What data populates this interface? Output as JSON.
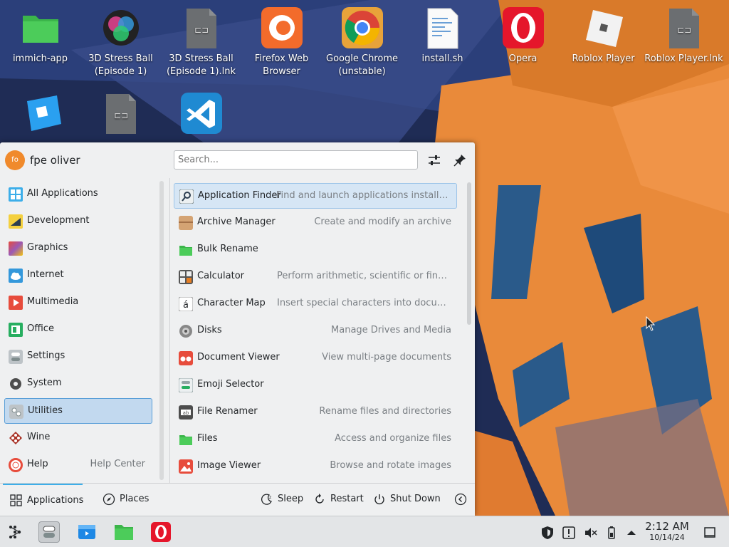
{
  "desktop": {
    "icons": [
      {
        "label": "immich-app",
        "icon": "folder-icon"
      },
      {
        "label": "3D Stress Ball (Episode 1)",
        "icon": "stress-ball-icon"
      },
      {
        "label": "3D Stress Ball (Episode 1).lnk",
        "icon": "link-file-icon"
      },
      {
        "label": "Firefox Web Browser",
        "icon": "firefox-icon"
      },
      {
        "label": "Google Chrome (unstable)",
        "icon": "chrome-icon"
      },
      {
        "label": "install.sh",
        "icon": "script-file-icon"
      },
      {
        "label": "Opera",
        "icon": "opera-icon"
      },
      {
        "label": "Roblox Player",
        "icon": "roblox-icon"
      },
      {
        "label": "Roblox Player.lnk",
        "icon": "link-file-icon"
      },
      {
        "label": "",
        "icon": "roblox-studio-icon"
      },
      {
        "label": "",
        "icon": "link-file-icon"
      },
      {
        "label": "",
        "icon": "vscode-icon"
      }
    ]
  },
  "menu": {
    "user": {
      "initials": "fo",
      "name": "fpe oliver"
    },
    "search": {
      "placeholder": "Search..."
    },
    "categories": [
      {
        "label": "All Applications",
        "icon": "grid-icon",
        "color": "#3daee9"
      },
      {
        "label": "Development",
        "icon": "development-icon",
        "color": "#f4d03f"
      },
      {
        "label": "Graphics",
        "icon": "graphics-icon",
        "color": "#c0392b"
      },
      {
        "label": "Internet",
        "icon": "internet-icon",
        "color": "#3498db"
      },
      {
        "label": "Multimedia",
        "icon": "multimedia-icon",
        "color": "#e74c3c"
      },
      {
        "label": "Office",
        "icon": "office-icon",
        "color": "#27ae60"
      },
      {
        "label": "Settings",
        "icon": "settings-icon",
        "color": "#95a5a6"
      },
      {
        "label": "System",
        "icon": "system-icon",
        "color": "#4d4d4d"
      },
      {
        "label": "Utilities",
        "icon": "utilities-icon",
        "color": "#bdc3c7",
        "selected": true
      },
      {
        "label": "Wine",
        "icon": "wine-icon",
        "color": "#a93226"
      },
      {
        "label": "Help",
        "icon": "help-icon",
        "color": "#e74c3c",
        "sub": "Help Center"
      }
    ],
    "apps": [
      {
        "name": "Application Finder",
        "desc": "Find and launch applications installed...",
        "icon": "magnifier-icon",
        "color": "#7f8c8d",
        "selected": true
      },
      {
        "name": "Archive Manager",
        "desc": "Create and modify an archive",
        "icon": "archive-icon",
        "color": "#d4a373"
      },
      {
        "name": "Bulk Rename",
        "desc": "",
        "icon": "folder-icon",
        "color": "#4caf50"
      },
      {
        "name": "Calculator",
        "desc": "Perform arithmetic, scientific or financial calc...",
        "icon": "calculator-icon",
        "color": "#555555"
      },
      {
        "name": "Character Map",
        "desc": "Insert special characters into documents",
        "icon": "character-map-icon",
        "color": "#ffffff"
      },
      {
        "name": "Disks",
        "desc": "Manage Drives and Media",
        "icon": "disk-icon",
        "color": "#888888"
      },
      {
        "name": "Document Viewer",
        "desc": "View multi-page documents",
        "icon": "document-viewer-icon",
        "color": "#e74c3c"
      },
      {
        "name": "Emoji Selector",
        "desc": "",
        "icon": "emoji-icon",
        "color": "#95a5a6"
      },
      {
        "name": "File Renamer",
        "desc": "Rename files and directories",
        "icon": "file-renamer-icon",
        "color": "#4d4d4d"
      },
      {
        "name": "Files",
        "desc": "Access and organize files",
        "icon": "folder-icon",
        "color": "#4caf50"
      },
      {
        "name": "Image Viewer",
        "desc": "Browse and rotate images",
        "icon": "image-viewer-icon",
        "color": "#e74c3c"
      }
    ],
    "footer": {
      "tabs": [
        {
          "label": "Applications",
          "active": true
        },
        {
          "label": "Places"
        }
      ],
      "actions": [
        {
          "label": "Sleep"
        },
        {
          "label": "Restart"
        },
        {
          "label": "Shut Down"
        }
      ]
    }
  },
  "panel": {
    "clock": {
      "time": "2:12 AM",
      "date": "10/14/24"
    }
  }
}
